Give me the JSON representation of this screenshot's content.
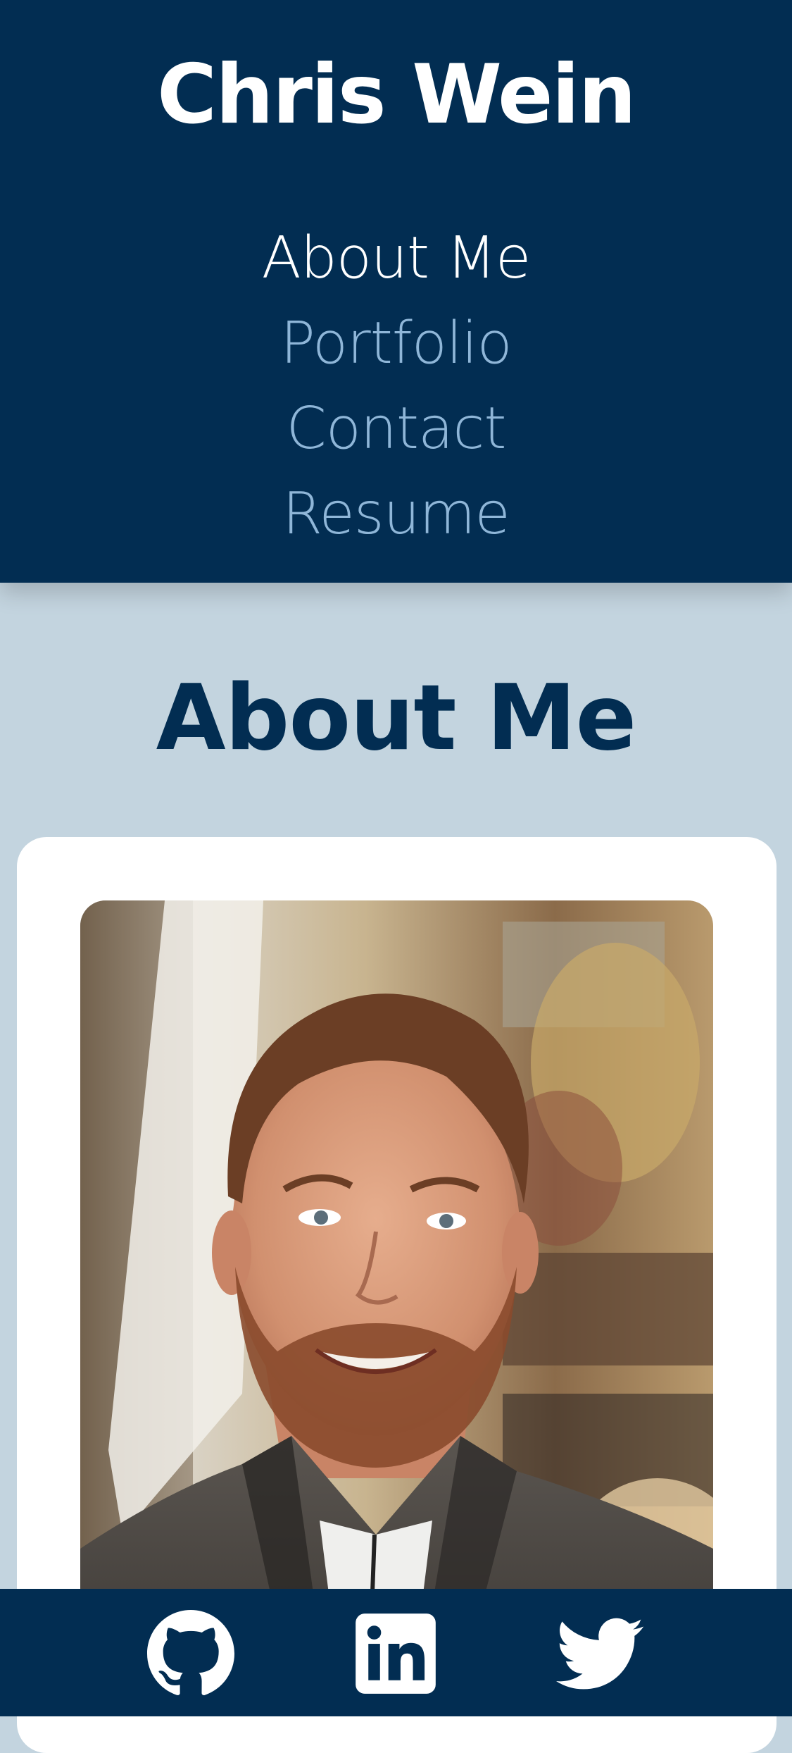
{
  "header": {
    "site_title": "Chris Wein",
    "nav": [
      {
        "label": "About Me",
        "active": true
      },
      {
        "label": "Portfolio",
        "active": false
      },
      {
        "label": "Contact",
        "active": false
      },
      {
        "label": "Resume",
        "active": false
      }
    ]
  },
  "main": {
    "section_title": "About Me",
    "photo": {
      "subject": "portrait photo of a smiling bearded man"
    }
  },
  "footer": {
    "social_links": [
      {
        "icon": "github-icon"
      },
      {
        "icon": "linkedin-icon"
      },
      {
        "icon": "twitter-icon"
      }
    ]
  },
  "colors": {
    "header_bg": "#022d52",
    "page_bg": "#c3d4df",
    "nav_active": "#ffffff",
    "nav_inactive": "#8fb6d8",
    "title_dark": "#022d52"
  }
}
